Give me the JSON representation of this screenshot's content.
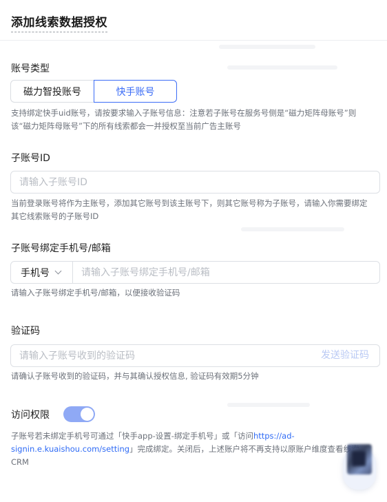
{
  "header": {
    "title": "添加线索数据授权"
  },
  "account_type": {
    "label": "账号类型",
    "options": [
      "磁力智投账号",
      "快手账号"
    ],
    "selected": "快手账号",
    "help": "支持绑定快手uid账号，请按要求输入子账号信息：注意若子账号在服务号侧是“磁力矩阵母账号”则该“磁力矩阵母账号”下的所有线索都会一并授权至当前广告主账号"
  },
  "sub_account_id": {
    "label": "子账号ID",
    "placeholder": "请输入子账号ID",
    "value": "",
    "help": "当前登录账号将作为主账号，添加其它账号到该主账号下，则其它账号称为子账号，请输入你需要绑定其它线索账号的子账号ID"
  },
  "bind_contact": {
    "label": "子账号绑定手机号/邮箱",
    "select_value": "手机号",
    "placeholder": "请输入子账号绑定手机号/邮箱",
    "value": "",
    "help": "请输入子账号绑定手机号/邮箱，以便接收验证码"
  },
  "verify_code": {
    "label": "验证码",
    "placeholder": "请输入子账号收到的验证码",
    "value": "",
    "send_label": "发送验证码",
    "help": "请确认子账号收到的验证码，并与其确认授权信息, 验证码有效期5分钟"
  },
  "access": {
    "label": "访问权限",
    "enabled": true,
    "help_prefix": "子账号若未绑定手机号可通过「快手app-设置-绑定手机号」或「访问",
    "help_link": "https://ad-signin.e.kuaishou.com/setting",
    "help_suffix": "」完成绑定。关闭后，上述账户将不再支持以原账户维度查看线索CRM"
  },
  "colors": {
    "accent": "#3b6cf6",
    "toggle_on": "#8fa9f5",
    "link": "#2f6bf5"
  },
  "icons": {
    "select_chevron": "chevron-down-icon",
    "float_button": "avatar-icon"
  }
}
